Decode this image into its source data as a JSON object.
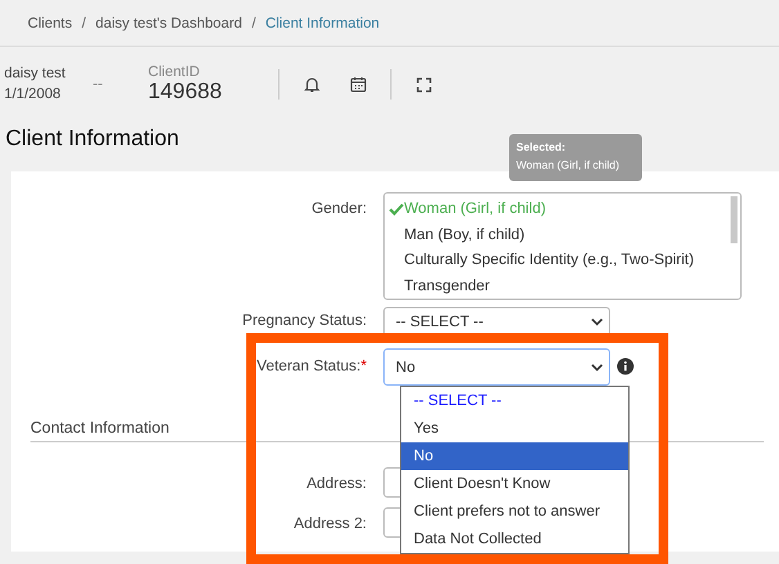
{
  "breadcrumb": [
    {
      "kind": "link",
      "label": "Clients",
      "current": false
    },
    {
      "kind": "separator",
      "label": "/"
    },
    {
      "kind": "link",
      "label": "daisy test's Dashboard",
      "current": false
    },
    {
      "kind": "separator",
      "label": "/"
    },
    {
      "kind": "link",
      "label": "Client Information",
      "current": true
    }
  ],
  "client": {
    "name": "daisy test",
    "dob": "1/1/2008",
    "separator": "--",
    "id_label": "ClientID",
    "id_value": "149688"
  },
  "page_title": "Client Information",
  "gender": {
    "label": "Gender:",
    "tooltip": {
      "title": "Selected:",
      "value": "Woman (Girl, if child)"
    },
    "options": [
      {
        "label": "Woman (Girl, if child)",
        "selected": true
      },
      {
        "label": "Man (Boy, if child)",
        "selected": false
      },
      {
        "label": "Culturally Specific Identity (e.g., Two-Spirit)",
        "selected": false
      },
      {
        "label": "Transgender",
        "selected": false
      }
    ]
  },
  "pregnancy": {
    "label": "Pregnancy Status:",
    "value": "-- SELECT --"
  },
  "veteran": {
    "label": "Veteran Status:",
    "required_mark": "*",
    "value": "No",
    "open": true,
    "options": [
      {
        "label": "-- SELECT --",
        "kind": "placeholder",
        "selected": false
      },
      {
        "label": "Yes",
        "kind": "option",
        "selected": false
      },
      {
        "label": "No",
        "kind": "option",
        "selected": true
      },
      {
        "label": "Client Doesn't Know",
        "kind": "option",
        "selected": false
      },
      {
        "label": "Client prefers not to answer",
        "kind": "option",
        "selected": false
      },
      {
        "label": "Data Not Collected",
        "kind": "option",
        "selected": false
      }
    ]
  },
  "section_title": "Contact Information",
  "address_fields": [
    {
      "label": "Address:"
    },
    {
      "label": "Address 2:"
    }
  ]
}
